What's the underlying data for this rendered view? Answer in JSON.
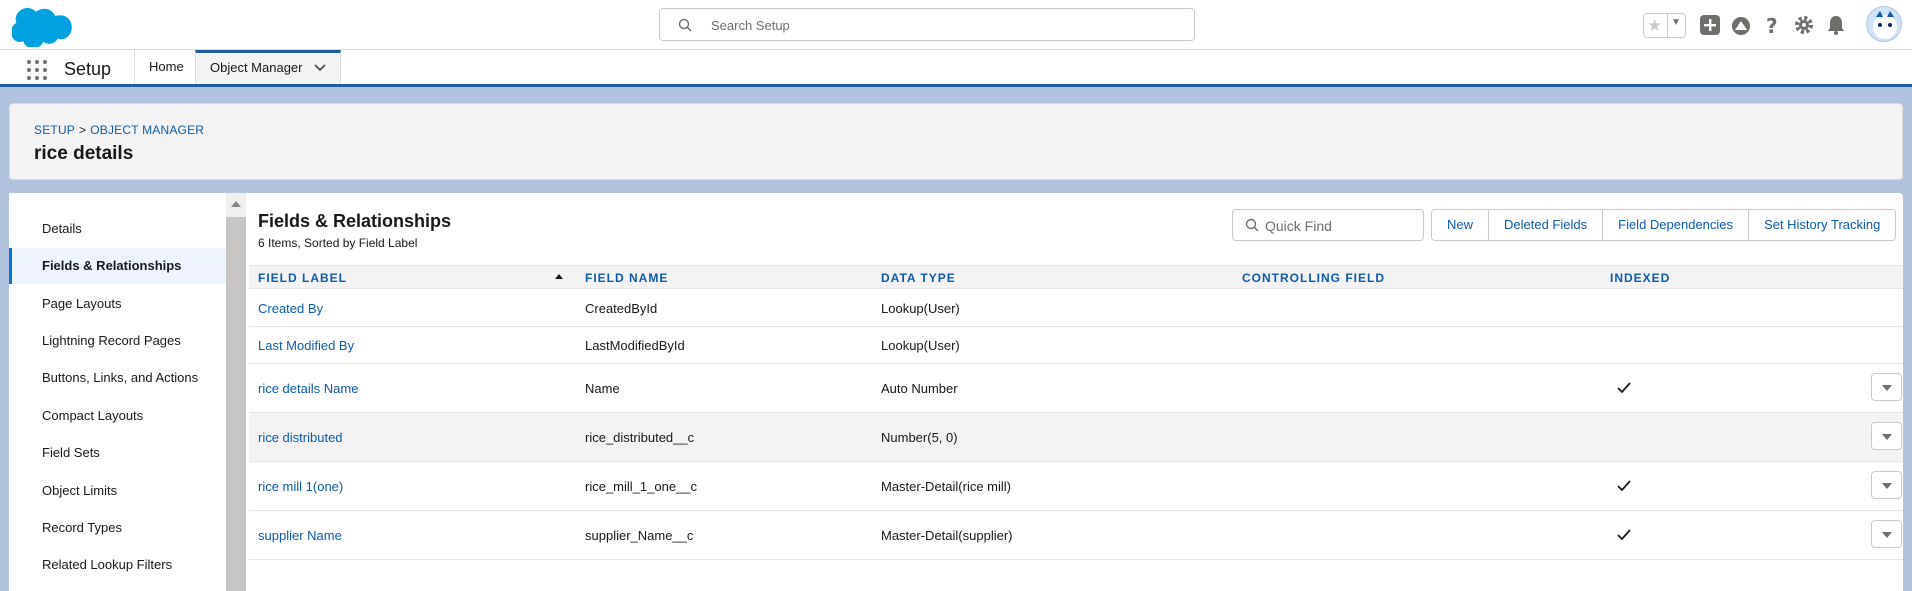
{
  "global_header": {
    "search_placeholder": "Search Setup"
  },
  "app_nav": {
    "app_name": "Setup",
    "tabs": [
      {
        "label": "Home"
      },
      {
        "label": "Object Manager"
      }
    ]
  },
  "page_header": {
    "breadcrumb": [
      "SETUP",
      ">",
      "OBJECT MANAGER"
    ],
    "title": "rice details"
  },
  "sidebar": {
    "items": [
      {
        "label": "Details"
      },
      {
        "label": "Fields & Relationships",
        "active": true
      },
      {
        "label": "Page Layouts"
      },
      {
        "label": "Lightning Record Pages"
      },
      {
        "label": "Buttons, Links, and Actions"
      },
      {
        "label": "Compact Layouts"
      },
      {
        "label": "Field Sets"
      },
      {
        "label": "Object Limits"
      },
      {
        "label": "Record Types"
      },
      {
        "label": "Related Lookup Filters"
      }
    ]
  },
  "section": {
    "title": "Fields & Relationships",
    "subtitle": "6 Items, Sorted by Field Label",
    "quick_find_placeholder": "Quick Find",
    "buttons": [
      "New",
      "Deleted Fields",
      "Field Dependencies",
      "Set History Tracking"
    ]
  },
  "table": {
    "columns": [
      "FIELD LABEL",
      "FIELD NAME",
      "DATA TYPE",
      "CONTROLLING FIELD",
      "INDEXED"
    ],
    "rows": [
      {
        "label": "Created By",
        "name": "CreatedById",
        "type": "Lookup(User)",
        "controlling": "",
        "indexed": false,
        "has_action": false
      },
      {
        "label": "Last Modified By",
        "name": "LastModifiedById",
        "type": "Lookup(User)",
        "controlling": "",
        "indexed": false,
        "has_action": false
      },
      {
        "label": "rice details Name",
        "name": "Name",
        "type": "Auto Number",
        "controlling": "",
        "indexed": true,
        "has_action": true
      },
      {
        "label": "rice distributed",
        "name": "rice_distributed__c",
        "type": "Number(5, 0)",
        "controlling": "",
        "indexed": false,
        "has_action": true
      },
      {
        "label": "rice mill 1(one)",
        "name": "rice_mill_1_one__c",
        "type": "Master-Detail(rice mill)",
        "controlling": "",
        "indexed": true,
        "has_action": true
      },
      {
        "label": "supplier Name",
        "name": "supplier_Name__c",
        "type": "Master-Detail(supplier)",
        "controlling": "",
        "indexed": true,
        "has_action": true
      }
    ]
  },
  "colors": {
    "brand_blue": "#0176d3",
    "link_blue": "#0b5cab",
    "nav_border": "#1b5f9e"
  }
}
